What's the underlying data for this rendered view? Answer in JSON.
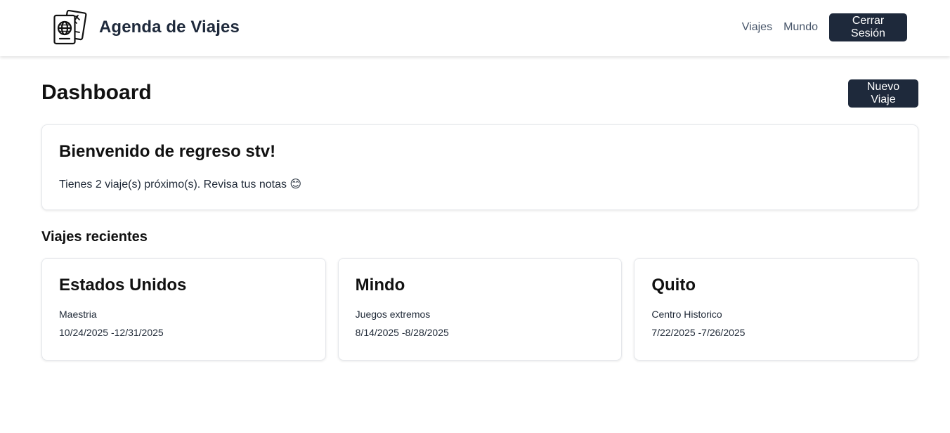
{
  "app": {
    "title": "Agenda de Viajes",
    "logo_icon": "passport-icon"
  },
  "nav": {
    "links": [
      "Viajes",
      "Mundo"
    ],
    "logout_label": "Cerrar Sesión"
  },
  "page": {
    "title": "Dashboard",
    "new_trip_label": "Nuevo Viaje"
  },
  "welcome": {
    "title": "Bienvenido de regreso stv!",
    "message": "Tienes 2 viaje(s) próximo(s). Revisa tus notas 😊"
  },
  "recent": {
    "title": "Viajes recientes",
    "trips": [
      {
        "name": "Estados Unidos",
        "description": "Maestria",
        "dates": "10/24/2025 -12/31/2025"
      },
      {
        "name": "Mindo",
        "description": "Juegos extremos",
        "dates": "8/14/2025 -8/28/2025"
      },
      {
        "name": "Quito",
        "description": "Centro Historico",
        "dates": "7/22/2025 -7/26/2025"
      }
    ]
  },
  "colors": {
    "primary_dark": "#1e293b",
    "nav_text": "#475569",
    "card_border": "#e5e7eb"
  }
}
